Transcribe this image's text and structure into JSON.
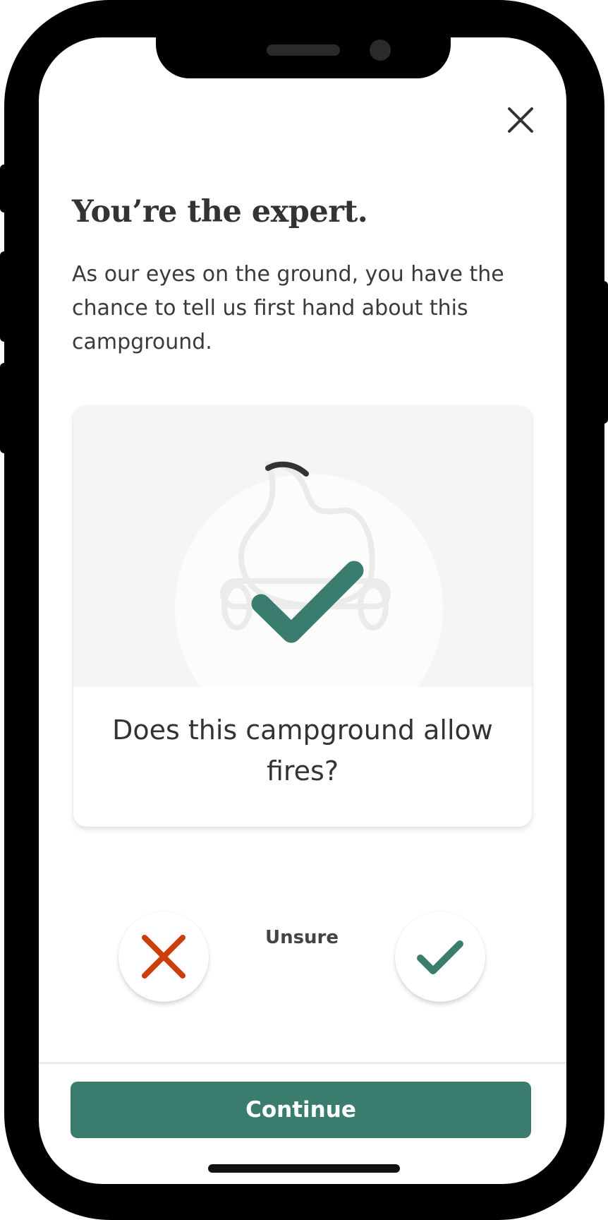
{
  "colors": {
    "brand_green": "#3a7d6e",
    "no_red": "#cc3f0c",
    "text_dark": "#333333",
    "illustration_bg": "#f5f5f4"
  },
  "header": {
    "close_icon": "close-icon"
  },
  "intro": {
    "title": "You’re the expert.",
    "body": "As our eyes on the ground, you have the chance to tell us first hand about this campground."
  },
  "card": {
    "illustration_icon": "campfire-check-icon",
    "question": "Does this campground allow fires?"
  },
  "answers": {
    "no_icon": "x-icon",
    "unsure_label": "Unsure",
    "yes_icon": "checkmark-icon"
  },
  "footer": {
    "continue_label": "Continue"
  }
}
